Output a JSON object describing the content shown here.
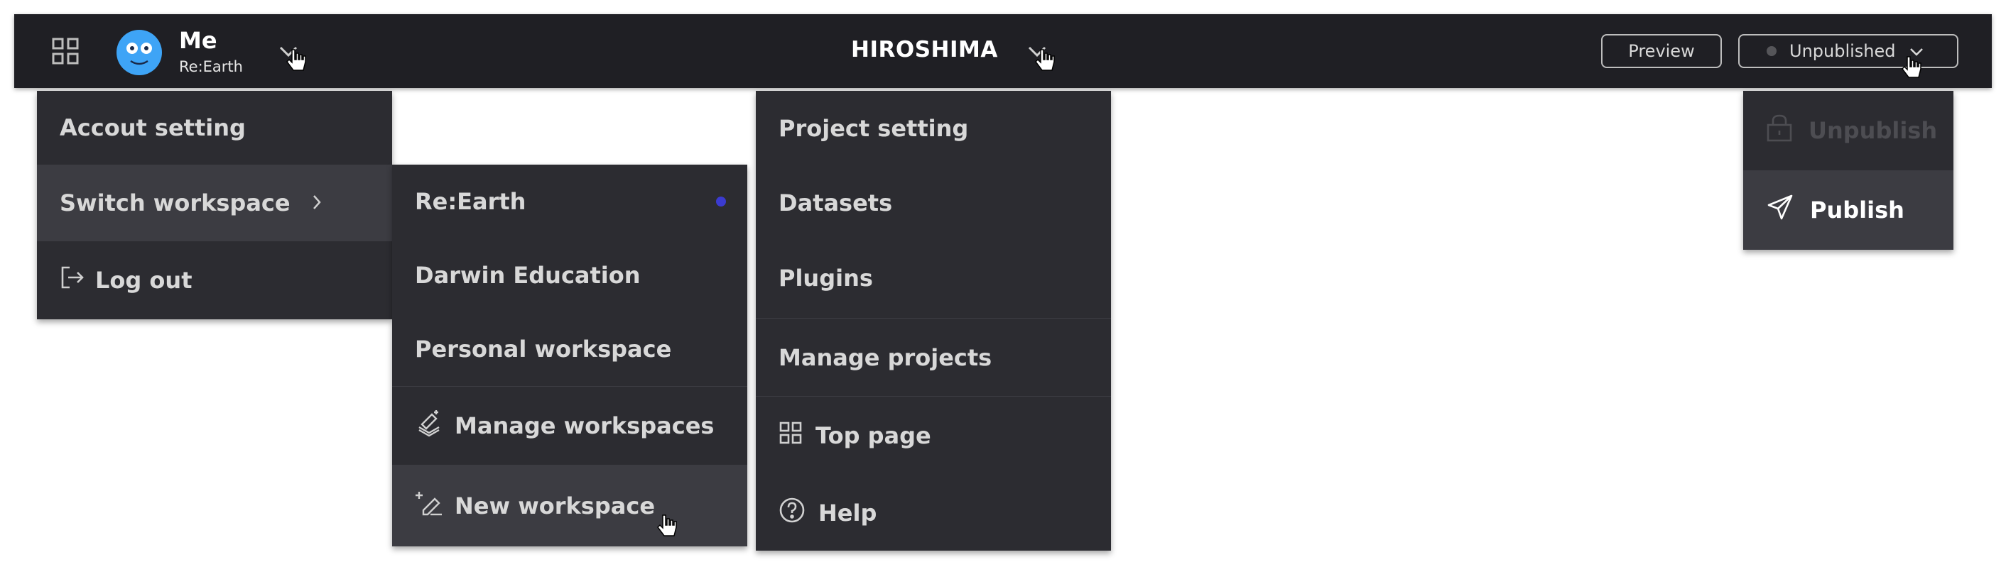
{
  "header": {
    "user_name": "Me",
    "user_workspace": "Re:Earth",
    "project_title": "HIROSHIMA",
    "preview_label": "Preview",
    "publish_status_label": "Unpublished"
  },
  "account_menu": {
    "items": [
      {
        "label": "Accout setting"
      },
      {
        "label": "Switch workspace"
      },
      {
        "label": "Log out"
      }
    ]
  },
  "workspace_menu": {
    "workspaces": [
      {
        "label": "Re:Earth",
        "active": true
      },
      {
        "label": "Darwin Education"
      },
      {
        "label": "Personal workspace"
      }
    ],
    "manage_label": "Manage workspaces",
    "new_label": "New workspace"
  },
  "project_menu": {
    "items": [
      {
        "label": "Project setting"
      },
      {
        "label": "Datasets"
      },
      {
        "label": "Plugins"
      },
      {
        "label": "Manage projects"
      },
      {
        "label": "Top page"
      },
      {
        "label": "Help"
      }
    ]
  },
  "publish_menu": {
    "unpublish_label": "Unpublish",
    "publish_label": "Publish"
  },
  "colors": {
    "header_bg": "#1f1f24",
    "menu_bg": "#2c2c31",
    "menu_hover_bg": "#3c3c42",
    "active_dot": "#3b3bd0",
    "avatar": "#3ea4f6"
  }
}
